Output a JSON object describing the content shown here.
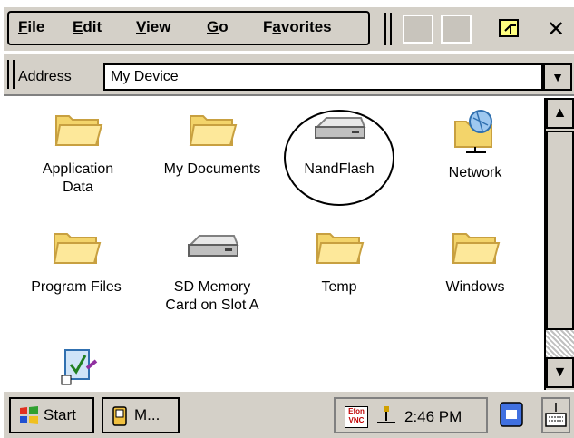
{
  "menubar": {
    "items": [
      {
        "label": "File",
        "underline": "F"
      },
      {
        "label": "Edit",
        "underline": "E"
      },
      {
        "label": "View",
        "underline": "V"
      },
      {
        "label": "Go",
        "underline": "G"
      },
      {
        "label": "Favorites",
        "underline": "a"
      }
    ],
    "close_label": "✕"
  },
  "address": {
    "label": "Address",
    "value": "My Device"
  },
  "items": [
    {
      "label": "Application Data",
      "icon": "folder-icon"
    },
    {
      "label": "My Documents",
      "icon": "folder-icon"
    },
    {
      "label": "NandFlash",
      "icon": "drive-icon"
    },
    {
      "label": "Network",
      "icon": "network-folder-icon"
    },
    {
      "label": "Program Files",
      "icon": "folder-icon"
    },
    {
      "label": "SD Memory Card on Slot A",
      "icon": "drive-icon"
    },
    {
      "label": "Temp",
      "icon": "folder-icon"
    },
    {
      "label": "Windows",
      "icon": "folder-icon"
    },
    {
      "label": "",
      "icon": "control-panel-icon"
    }
  ],
  "taskbar": {
    "start_label": "Start",
    "task_label": "M...",
    "tray_badge": "Efon VNC",
    "clock": "2:46 PM"
  },
  "colors": {
    "chrome": "#d4d0c8",
    "folder": "#f8e08a",
    "folder_edge": "#c8a040"
  }
}
